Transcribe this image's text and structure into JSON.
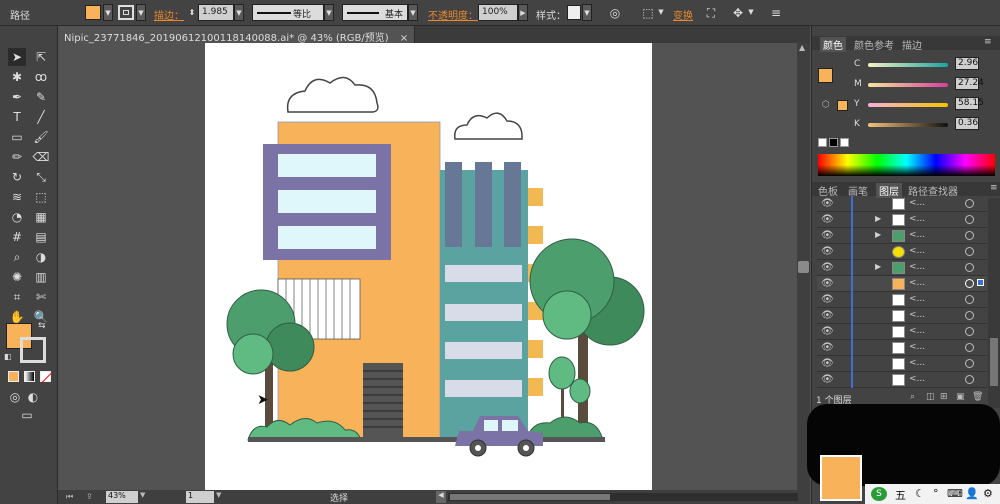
{
  "control_bar": {
    "object_type": "路径",
    "stroke_label": "描边：",
    "stroke_weight": "1.985",
    "profile_label": "等比",
    "brush_label": "基本",
    "opacity_label": "不透明度：",
    "opacity_value": "100%",
    "style_label": "样式：",
    "transform_label": "变换"
  },
  "document_tab": {
    "title": "Nipic_23771846_20190612100118140088.ai* @ 43% (RGB/预览)",
    "close": "×"
  },
  "status_bar": {
    "zoom": "43%",
    "page": "1",
    "tool_label": "选择"
  },
  "panels": {
    "color_tabs": [
      "颜色",
      "颜色参考",
      "描边"
    ],
    "channels": [
      {
        "label": "C",
        "value": "2.96"
      },
      {
        "label": "M",
        "value": "27.24"
      },
      {
        "label": "Y",
        "value": "58.15"
      },
      {
        "label": "K",
        "value": "0.36"
      }
    ],
    "layer_tabs": [
      "色板",
      "画笔",
      "图层",
      "路径查找器"
    ],
    "layer_rows": [
      "<...",
      "<...",
      "<...",
      "<...",
      "<...",
      "<...",
      "<...",
      "<...",
      "<...",
      "<...",
      "<...",
      "<..."
    ],
    "layer_count": "1 个图层"
  },
  "colors": {
    "fill": "#f8b35a",
    "accent": "#3b6fd6",
    "tower_teal": "#5ba3a0",
    "window_frame": "#7b73a6",
    "tree_green": "#4d9e6d"
  },
  "tray": {
    "ime": "五"
  }
}
